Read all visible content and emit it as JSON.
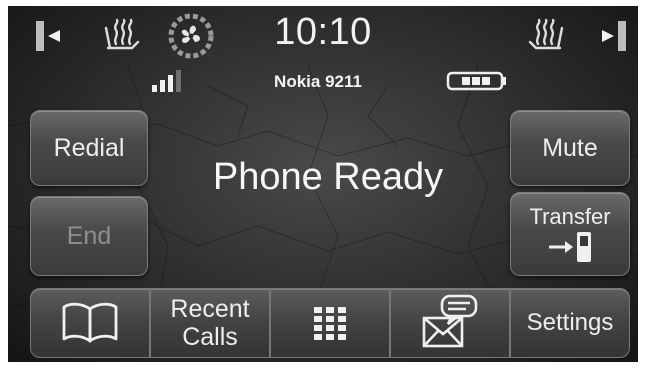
{
  "top_bar": {
    "time": "10:10",
    "left_arrow_icon": "left-arrow-icon",
    "right_arrow_icon": "right-arrow-icon",
    "left_seat_icon": "heated-seat-icon",
    "fan_icon": "climate-fan-icon",
    "right_seat_icon": "heated-seat-icon"
  },
  "status": {
    "device_name": "Nokia 9211",
    "signal_icon": "signal-strength-icon",
    "battery_icon": "battery-icon"
  },
  "main": {
    "status_text": "Phone Ready"
  },
  "buttons": {
    "redial": "Redial",
    "end": "End",
    "mute": "Mute",
    "transfer": "Transfer"
  },
  "bottom_bar": {
    "phonebook_icon": "phonebook-icon",
    "recent_calls_line1": "Recent",
    "recent_calls_line2": "Calls",
    "keypad_icon": "keypad-icon",
    "messaging_icon": "messaging-icon",
    "settings": "Settings"
  },
  "colors": {
    "screen_bg": "#2c2c2c",
    "text": "#f2f2f2",
    "disabled_text": "#8f8f8f"
  }
}
